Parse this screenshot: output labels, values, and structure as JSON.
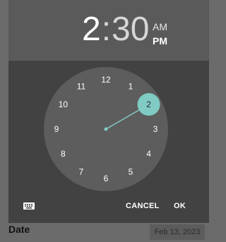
{
  "time_picker": {
    "hour": "2",
    "separator": ":",
    "minute": "30",
    "am_label": "AM",
    "pm_label": "PM",
    "selected_period": "PM",
    "selected_hour": 2,
    "dial_hours": [
      "12",
      "1",
      "2",
      "3",
      "4",
      "5",
      "6",
      "7",
      "8",
      "9",
      "10",
      "11"
    ],
    "accent_color": "#80cbc4",
    "cancel_label": "CANCEL",
    "ok_label": "OK",
    "keyboard_toggle_icon": "keyboard-icon"
  },
  "form": {
    "date_label": "Date",
    "date_value": "Feb 13, 2023"
  }
}
